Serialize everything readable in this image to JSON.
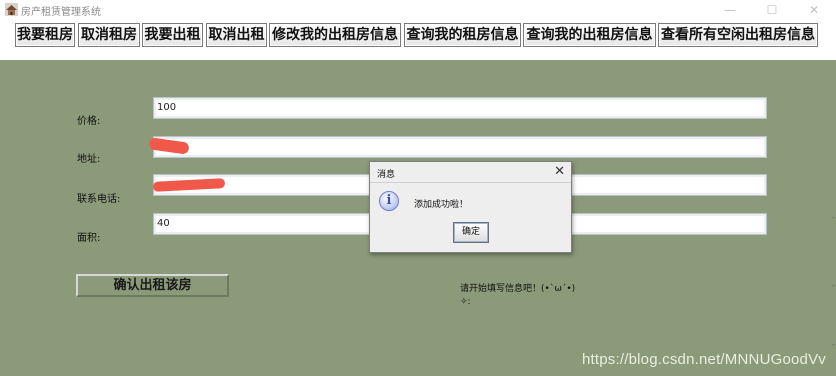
{
  "window": {
    "title": "房产租赁管理系统",
    "minimize_glyph": "—",
    "maximize_glyph": "☐",
    "close_glyph": "✕"
  },
  "toolbar": {
    "buttons": [
      "我要租房",
      "取消租房",
      "我要出租",
      "取消出租",
      "修改我的出租房信息",
      "查询我的租房信息",
      "查询我的出租房信息",
      "查看所有空闲出租房信息"
    ]
  },
  "form": {
    "price_label": "价格:",
    "price_value": "100",
    "address_label": "地址:",
    "address_value": "",
    "phone_label": "联系电话:",
    "phone_value": "",
    "area_label": "面积:",
    "area_value": "40",
    "confirm_label": "确认出租该房"
  },
  "hint": {
    "line1": "请开始填写信息吧！(•ˋωˊ•)",
    "line2": "✧:"
  },
  "dialog": {
    "title": "消息",
    "close_glyph": "✕",
    "icon": "info-icon",
    "icon_glyph": "i",
    "message": "添加成功啦！",
    "ok_label": "确定"
  },
  "watermark": "https://blog.csdn.net/MNNUGoodVv",
  "edge_marks": [
    "-",
    "-",
    "-"
  ],
  "colors": {
    "panel_bg": "#8b9a79",
    "dialog_bg": "#eeeeee",
    "redaction": "#f0584a"
  }
}
